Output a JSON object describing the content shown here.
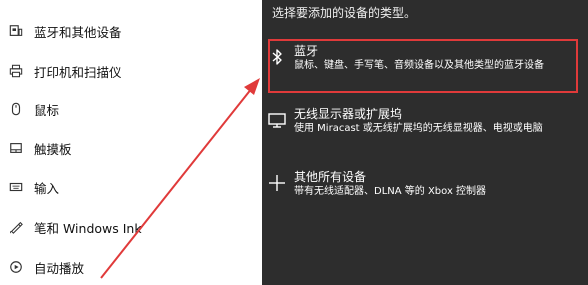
{
  "sidebar": {
    "items": [
      {
        "label": "蓝牙和其他设备",
        "icon": "bluetooth-devices-icon"
      },
      {
        "label": "打印机和扫描仪",
        "icon": "printer-icon"
      },
      {
        "label": "鼠标",
        "icon": "mouse-icon"
      },
      {
        "label": "触摸板",
        "icon": "touchpad-icon"
      },
      {
        "label": "输入",
        "icon": "keyboard-icon"
      },
      {
        "label": "笔和 Windows Ink",
        "icon": "pen-icon"
      },
      {
        "label": "自动播放",
        "icon": "autoplay-icon"
      }
    ]
  },
  "dialog": {
    "subtitle": "选择要添加的设备的类型。",
    "options": [
      {
        "title": "蓝牙",
        "description": "鼠标、键盘、手写笔、音频设备以及其他类型的蓝牙设备",
        "icon": "bluetooth-icon"
      },
      {
        "title": "无线显示器或扩展坞",
        "description": "使用 Miracast 或无线扩展坞的无线显视器、电视或电脑",
        "icon": "monitor-icon"
      },
      {
        "title": "其他所有设备",
        "description": "带有无线适配器、DLNA 等的 Xbox 控制器",
        "icon": "plus-icon"
      }
    ]
  },
  "annotation": {
    "highlight_color": "#e03a3a",
    "arrow_color": "#e03a3a"
  },
  "colors": {
    "dialog_background": "#2d2d2d",
    "sidebar_background": "#ffffff"
  }
}
